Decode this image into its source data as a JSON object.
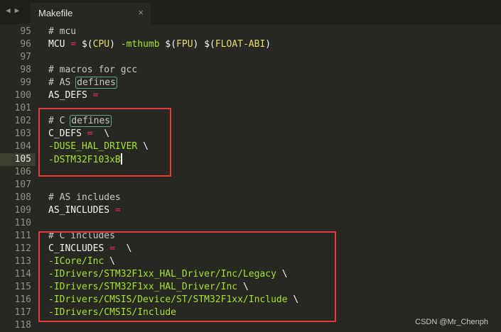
{
  "tab": {
    "title": "Makefile"
  },
  "icons": {
    "nav_back": "◀",
    "nav_forward": "▶",
    "close": "×"
  },
  "lines": [
    {
      "n": "95",
      "parts": [
        {
          "t": "# mcu",
          "c": "t-comment"
        }
      ]
    },
    {
      "n": "96",
      "parts": [
        {
          "t": "MCU ",
          "c": "t-var"
        },
        {
          "t": "= ",
          "c": "t-op"
        },
        {
          "t": "$(",
          "c": "t-white"
        },
        {
          "t": "CPU",
          "c": "t-str"
        },
        {
          "t": ") ",
          "c": "t-white"
        },
        {
          "t": "-mthumb ",
          "c": "t-green"
        },
        {
          "t": "$(",
          "c": "t-white"
        },
        {
          "t": "FPU",
          "c": "t-str"
        },
        {
          "t": ") ",
          "c": "t-white"
        },
        {
          "t": "$(",
          "c": "t-white"
        },
        {
          "t": "FLOAT-ABI",
          "c": "t-str"
        },
        {
          "t": ")",
          "c": "t-white"
        }
      ]
    },
    {
      "n": "97",
      "parts": []
    },
    {
      "n": "98",
      "parts": [
        {
          "t": "# macros for gcc",
          "c": "t-comment"
        }
      ]
    },
    {
      "n": "99",
      "parts": [
        {
          "t": "# AS ",
          "c": "t-comment"
        },
        {
          "t": "defines",
          "c": "t-comment boxed"
        }
      ]
    },
    {
      "n": "100",
      "parts": [
        {
          "t": "AS_DEFS ",
          "c": "t-var"
        },
        {
          "t": "=",
          "c": "t-op"
        }
      ]
    },
    {
      "n": "101",
      "parts": []
    },
    {
      "n": "102",
      "parts": [
        {
          "t": "# C ",
          "c": "t-comment"
        },
        {
          "t": "defines",
          "c": "t-comment boxed"
        }
      ]
    },
    {
      "n": "103",
      "parts": [
        {
          "t": "C_DEFS ",
          "c": "t-var"
        },
        {
          "t": "=",
          "c": "t-op"
        },
        {
          "t": "  \\",
          "c": "t-white"
        }
      ]
    },
    {
      "n": "104",
      "parts": [
        {
          "t": "-DUSE_HAL_DRIVER ",
          "c": "t-green"
        },
        {
          "t": "\\",
          "c": "t-white"
        }
      ]
    },
    {
      "n": "105",
      "parts": [
        {
          "t": "-DSTM32F103xB",
          "c": "t-green"
        }
      ],
      "active": true,
      "cursor": true
    },
    {
      "n": "106",
      "parts": []
    },
    {
      "n": "107",
      "parts": []
    },
    {
      "n": "108",
      "parts": [
        {
          "t": "# AS includes",
          "c": "t-comment"
        }
      ]
    },
    {
      "n": "109",
      "parts": [
        {
          "t": "AS_INCLUDES ",
          "c": "t-var"
        },
        {
          "t": "=",
          "c": "t-op"
        }
      ]
    },
    {
      "n": "110",
      "parts": []
    },
    {
      "n": "111",
      "parts": [
        {
          "t": "# C includes",
          "c": "t-comment"
        }
      ]
    },
    {
      "n": "112",
      "parts": [
        {
          "t": "C_INCLUDES ",
          "c": "t-var"
        },
        {
          "t": "=",
          "c": "t-op"
        },
        {
          "t": "  \\",
          "c": "t-white"
        }
      ]
    },
    {
      "n": "113",
      "parts": [
        {
          "t": "-ICore/Inc ",
          "c": "t-green"
        },
        {
          "t": "\\",
          "c": "t-white"
        }
      ]
    },
    {
      "n": "114",
      "parts": [
        {
          "t": "-IDrivers/STM32F1xx_HAL_Driver/Inc/Legacy ",
          "c": "t-green"
        },
        {
          "t": "\\",
          "c": "t-white"
        }
      ]
    },
    {
      "n": "115",
      "parts": [
        {
          "t": "-IDrivers/STM32F1xx_HAL_Driver/Inc ",
          "c": "t-green"
        },
        {
          "t": "\\",
          "c": "t-white"
        }
      ]
    },
    {
      "n": "116",
      "parts": [
        {
          "t": "-IDrivers/CMSIS/Device/ST/STM32F1xx/Include ",
          "c": "t-green"
        },
        {
          "t": "\\",
          "c": "t-white"
        }
      ]
    },
    {
      "n": "117",
      "parts": [
        {
          "t": "-IDrivers/CMSIS/Include",
          "c": "t-green"
        }
      ]
    },
    {
      "n": "118",
      "parts": []
    }
  ],
  "watermark": "CSDN @Mr_Chenph"
}
